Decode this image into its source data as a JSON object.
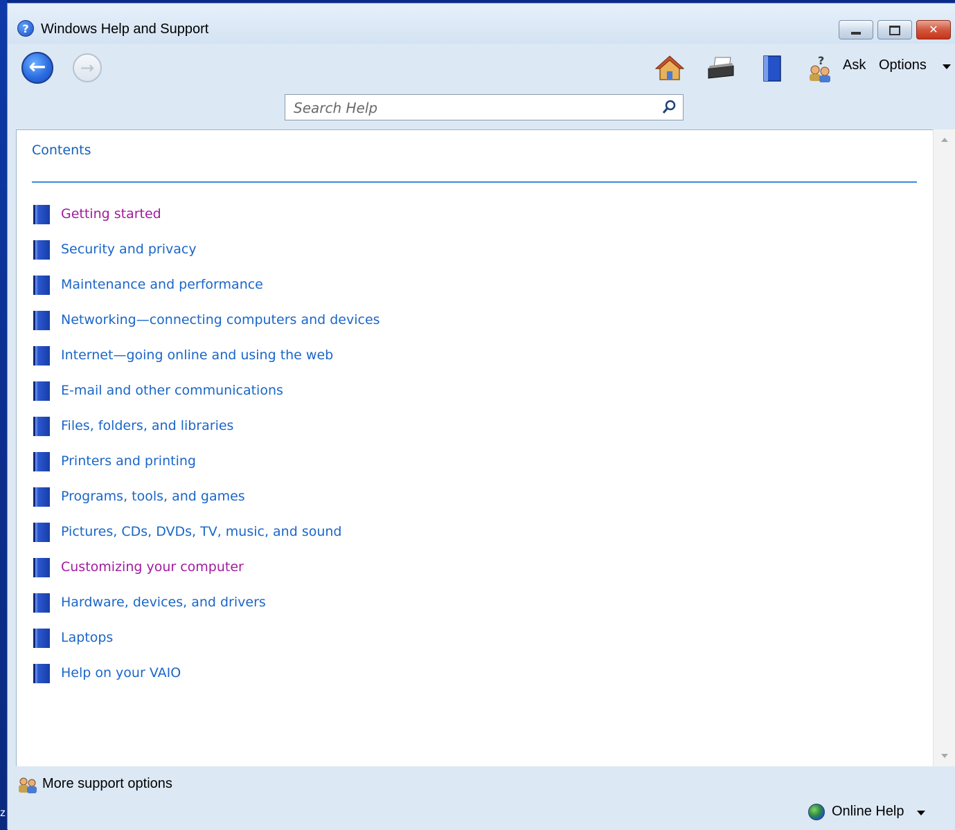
{
  "window": {
    "title": "Windows Help and Support"
  },
  "desktop": {
    "edge_text": "z"
  },
  "toolbar": {
    "back_icon": "back-arrow-icon",
    "forward_icon": "forward-arrow-icon",
    "home_icon": "house-icon",
    "print_icon": "printer-icon",
    "browse_icon": "book-icon",
    "ask_icon": "people-question-icon",
    "ask_label": "Ask",
    "options_label": "Options"
  },
  "search": {
    "placeholder": "Search Help"
  },
  "content": {
    "heading": "Contents",
    "topics": [
      {
        "label": "Getting started",
        "visited": true
      },
      {
        "label": "Security and privacy",
        "visited": false
      },
      {
        "label": "Maintenance and performance",
        "visited": false
      },
      {
        "label": "Networking—connecting computers and devices",
        "visited": false
      },
      {
        "label": "Internet—going online and using the web",
        "visited": false
      },
      {
        "label": "E-mail and other communications",
        "visited": false
      },
      {
        "label": "Files, folders, and libraries",
        "visited": false
      },
      {
        "label": "Printers and printing",
        "visited": false
      },
      {
        "label": "Programs, tools, and games",
        "visited": false
      },
      {
        "label": "Pictures, CDs, DVDs, TV, music, and sound",
        "visited": false
      },
      {
        "label": "Customizing your computer",
        "visited": true
      },
      {
        "label": "Hardware, devices, and drivers",
        "visited": false
      },
      {
        "label": "Laptops",
        "visited": false
      },
      {
        "label": "Help on your VAIO",
        "visited": false
      }
    ]
  },
  "footer": {
    "more_support_label": "More support options",
    "online_help_label": "Online Help"
  },
  "colors": {
    "link": "#1a66c8",
    "visited_link": "#a11a9f",
    "heading": "#1460b8",
    "divider": "#3c8ad6",
    "chrome": "#dce8f4"
  }
}
